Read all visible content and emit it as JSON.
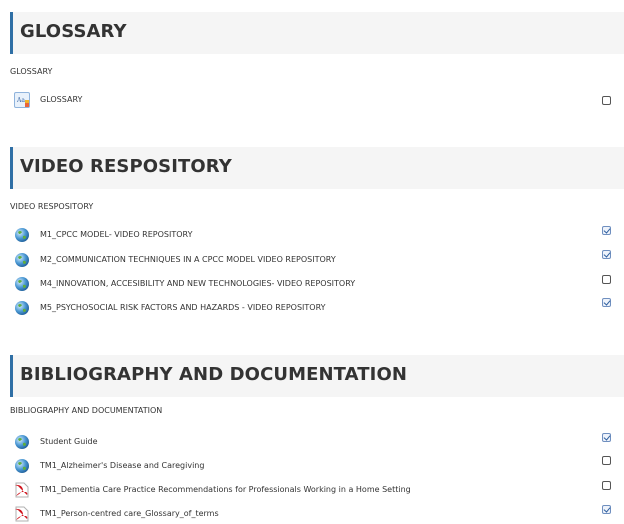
{
  "sections": [
    {
      "title": "GLOSSARY",
      "summary": "GLOSSARY",
      "activities": [
        {
          "label": "GLOSSARY",
          "icon": "glossary-icon",
          "completed": false
        }
      ]
    },
    {
      "title": "VIDEO RESPOSITORY",
      "summary": "VIDEO RESPOSITORY",
      "activities": [
        {
          "label": "M1_CPCC MODEL- VIDEO REPOSITORY",
          "icon": "url-globe-icon",
          "completed": true
        },
        {
          "label": "M2_COMMUNICATION TECHNIQUES IN A CPCC MODEL VIDEO REPOSITORY",
          "icon": "url-globe-icon",
          "completed": true
        },
        {
          "label": "M4_INNOVATION, ACCESIBILITY AND NEW TECHNOLOGIES- VIDEO REPOSITORY",
          "icon": "url-globe-icon",
          "completed": false
        },
        {
          "label": "M5_PSYCHOSOCIAL RISK FACTORS AND HAZARDS - VIDEO REPOSITORY",
          "icon": "url-globe-icon",
          "completed": true
        }
      ]
    },
    {
      "title": "BIBLIOGRAPHY AND DOCUMENTATION",
      "summary": "BIBLIOGRAPHY AND DOCUMENTATION",
      "activities": [
        {
          "label": "Student Guide",
          "icon": "url-globe-icon",
          "completed": true
        },
        {
          "label": "TM1_Alzheimer's Disease and Caregiving",
          "icon": "url-globe-icon",
          "completed": false
        },
        {
          "label": "TM1_Dementia Care Practice Recommendations for Professionals Working in a Home Setting",
          "icon": "pdf-file-icon",
          "completed": false
        },
        {
          "label": "TM1_Person-centred care_Glossary_of_terms",
          "icon": "pdf-file-icon",
          "completed": true
        }
      ]
    }
  ],
  "colors": {
    "header_bg": "#f5f5f5",
    "header_accent": "#2f6fa5",
    "text": "#333333"
  }
}
